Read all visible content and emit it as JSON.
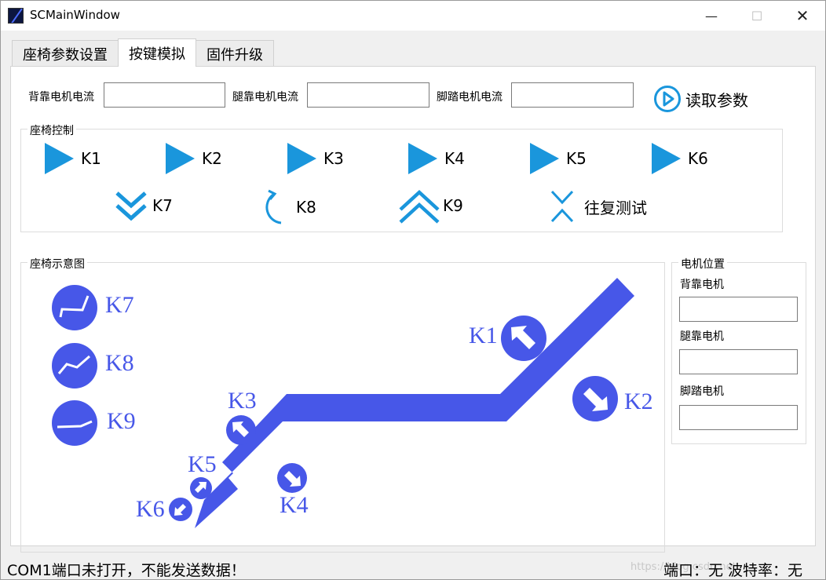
{
  "window": {
    "title": "SCMainWindow",
    "minimize": "—",
    "maximize": "☐",
    "close": "✕"
  },
  "tabs": [
    "座椅参数设置",
    "按键模拟",
    "固件升级"
  ],
  "params": {
    "back_current_label": "背靠电机电流",
    "leg_current_label": "腿靠电机电流",
    "foot_current_label": "脚踏电机电流",
    "back_current_value": "",
    "leg_current_value": "",
    "foot_current_value": "",
    "read_button": "读取参数"
  },
  "seat_control": {
    "title": "座椅控制",
    "buttons": [
      "K1",
      "K2",
      "K3",
      "K4",
      "K5",
      "K6",
      "K7",
      "K8",
      "K9",
      "往复测试"
    ]
  },
  "diagram": {
    "title": "座椅示意图",
    "labels": [
      "K1",
      "K2",
      "K3",
      "K4",
      "K5",
      "K6",
      "K7",
      "K8",
      "K9"
    ]
  },
  "motor_position": {
    "title": "电机位置",
    "back_label": "背靠电机",
    "leg_label": "腿靠电机",
    "foot_label": "脚踏电机",
    "back_value": "",
    "leg_value": "",
    "foot_value": ""
  },
  "status": {
    "message": "COM1端口未打开，不能发送数据！",
    "port_info": "端口：无 波特率：无",
    "watermark": "https://blog.csdn.net"
  },
  "colors": {
    "accent_blue": "#1a96dc",
    "diagram_blue": "#4757e8"
  }
}
